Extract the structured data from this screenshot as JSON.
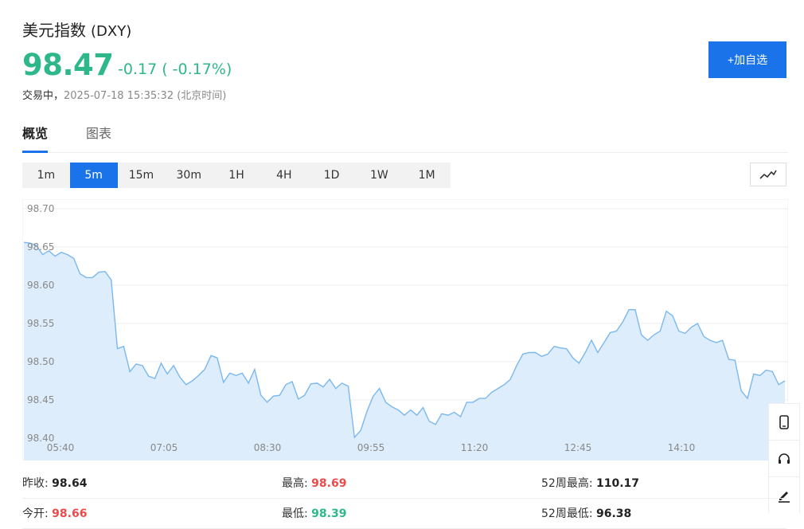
{
  "header": {
    "title": "美元指数",
    "code": "(DXY)",
    "price": "98.47",
    "change": "-0.17 ( -0.17%)",
    "status": "交易中，",
    "time": "2025-07-18 15:35:32 (北京时间)",
    "add_label": "+加自选",
    "price_color": "#2eb88a",
    "accent_color": "#1a73e8"
  },
  "tabs": [
    {
      "label": "概览",
      "active": true
    },
    {
      "label": "图表",
      "active": false
    }
  ],
  "timeframes": [
    {
      "label": "1m",
      "active": false
    },
    {
      "label": "5m",
      "active": true
    },
    {
      "label": "15m",
      "active": false
    },
    {
      "label": "30m",
      "active": false
    },
    {
      "label": "1H",
      "active": false
    },
    {
      "label": "4H",
      "active": false
    },
    {
      "label": "1D",
      "active": false
    },
    {
      "label": "1W",
      "active": false
    },
    {
      "label": "1M",
      "active": false
    }
  ],
  "chart_type_icon": "line-chart-icon",
  "chart_data": {
    "type": "area",
    "ylim": [
      98.4,
      98.7
    ],
    "yticks": [
      "98.70",
      "98.65",
      "98.60",
      "98.55",
      "98.50",
      "98.45",
      "98.40"
    ],
    "xticks": [
      "05:40",
      "07:05",
      "08:30",
      "09:55",
      "11:20",
      "12:45",
      "14:10"
    ],
    "grid": true,
    "line_color": "#7ab8ee",
    "fill_color": "#deedfb",
    "values": [
      98.656,
      98.655,
      98.652,
      98.64,
      98.645,
      98.638,
      98.643,
      98.64,
      98.635,
      98.615,
      98.61,
      98.61,
      98.617,
      98.618,
      98.607,
      98.517,
      98.52,
      98.487,
      98.497,
      98.495,
      98.481,
      98.478,
      98.498,
      98.484,
      98.495,
      98.48,
      98.47,
      98.475,
      98.482,
      98.49,
      98.508,
      98.505,
      98.473,
      98.485,
      98.482,
      98.485,
      98.472,
      98.49,
      98.456,
      98.447,
      98.455,
      98.456,
      98.47,
      98.474,
      98.451,
      98.456,
      98.471,
      98.472,
      98.467,
      98.477,
      98.465,
      98.472,
      98.468,
      98.401,
      98.41,
      98.435,
      98.455,
      98.465,
      98.447,
      98.441,
      98.437,
      98.43,
      98.437,
      98.43,
      98.44,
      98.422,
      98.418,
      98.432,
      98.43,
      98.434,
      98.428,
      98.447,
      98.447,
      98.452,
      98.452,
      98.46,
      98.465,
      98.47,
      98.477,
      98.495,
      98.51,
      98.512,
      98.512,
      98.507,
      98.51,
      98.52,
      98.518,
      98.517,
      98.505,
      98.498,
      98.512,
      98.528,
      98.512,
      98.525,
      98.538,
      98.54,
      98.552,
      98.568,
      98.568,
      98.535,
      98.528,
      98.535,
      98.54,
      98.566,
      98.56,
      98.54,
      98.537,
      98.545,
      98.55,
      98.533,
      98.528,
      98.525,
      98.528,
      98.503,
      98.502,
      98.462,
      98.452,
      98.484,
      98.482,
      98.489,
      98.487,
      98.47,
      98.475
    ]
  },
  "side_tools": [
    {
      "icon": "mobile-phone-icon"
    },
    {
      "icon": "headset-icon"
    },
    {
      "icon": "edit-pencil-icon"
    }
  ],
  "stats": {
    "prev_close_label": "昨收:",
    "prev_close": "98.64",
    "open_label": "今开:",
    "open": "98.66",
    "high_label": "最高:",
    "high": "98.69",
    "low_label": "最低:",
    "low": "98.39",
    "w52_high_label": "52周最高:",
    "w52_high": "110.17",
    "w52_low_label": "52周最低:",
    "w52_low": "96.38"
  }
}
